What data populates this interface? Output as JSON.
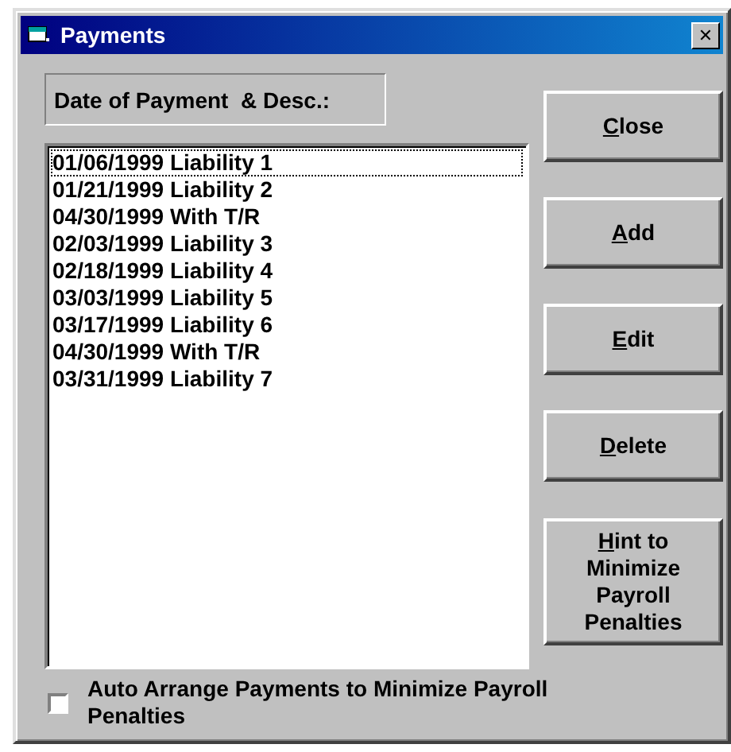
{
  "window": {
    "title": "Payments",
    "close_glyph": "✕"
  },
  "list_label": "Date of Payment  & Desc.:",
  "payments": [
    {
      "text": "01/06/1999 Liability 1",
      "selected": false,
      "focused": true
    },
    {
      "text": "01/21/1999 Liability 2",
      "selected": false,
      "focused": false
    },
    {
      "text": "04/30/1999 With T/R",
      "selected": false,
      "focused": false
    },
    {
      "text": "02/03/1999 Liability 3",
      "selected": false,
      "focused": false
    },
    {
      "text": "02/18/1999 Liability 4",
      "selected": false,
      "focused": false
    },
    {
      "text": "03/03/1999 Liability 5",
      "selected": false,
      "focused": false
    },
    {
      "text": "03/17/1999 Liability 6",
      "selected": false,
      "focused": false
    },
    {
      "text": "04/30/1999 With T/R",
      "selected": false,
      "focused": false
    },
    {
      "text": "03/31/1999 Liability 7",
      "selected": false,
      "focused": false
    }
  ],
  "buttons": [
    {
      "mnemonic": "C",
      "rest": "lose",
      "kind": "normal"
    },
    {
      "mnemonic": "A",
      "rest": "dd",
      "kind": "normal"
    },
    {
      "mnemonic": "E",
      "rest": "dit",
      "kind": "normal"
    },
    {
      "mnemonic": "D",
      "rest": "elete",
      "kind": "normal"
    },
    {
      "mnemonic": "H",
      "rest": "int to Minimize Payroll Penalties",
      "kind": "tall"
    }
  ],
  "auto_arrange": {
    "label": "Auto Arrange Payments to Minimize Payroll Penalties",
    "checked": false
  }
}
